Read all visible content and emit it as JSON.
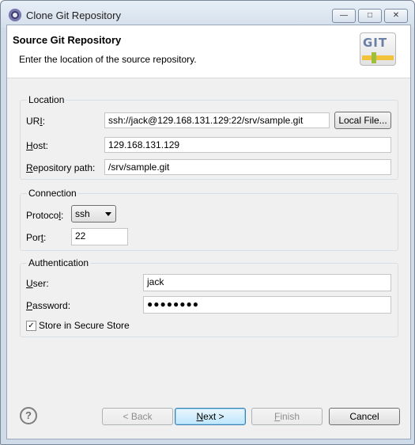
{
  "window": {
    "title": "Clone Git Repository",
    "controls": {
      "minimize": "—",
      "maximize": "□",
      "close": "✕"
    }
  },
  "header": {
    "title": "Source Git Repository",
    "description": "Enter the location of the source repository.",
    "icon_text": "GIT"
  },
  "location": {
    "legend": "Location",
    "uri_label_pre": "UR",
    "uri_label_u": "I",
    "uri_label_post": ":",
    "uri_value": "ssh://jack@129.168.131.129:22/srv/sample.git",
    "local_file_button": "Local File...",
    "host_label_u": "H",
    "host_label_post": "ost:",
    "host_value": "129.168.131.129",
    "repo_label_u": "R",
    "repo_label_post": "epository path:",
    "repo_value": "/srv/sample.git"
  },
  "connection": {
    "legend": "Connection",
    "protocol_label_pre": "Protoco",
    "protocol_label_u": "l",
    "protocol_label_post": ":",
    "protocol_value": "ssh",
    "port_label_pre": "Por",
    "port_label_u": "t",
    "port_label_post": ":",
    "port_value": "22"
  },
  "authentication": {
    "legend": "Authentication",
    "user_label_u": "U",
    "user_label_post": "ser:",
    "user_value": "jack",
    "password_label_u": "P",
    "password_label_post": "assword:",
    "password_value": "●●●●●●●●",
    "store_label": "Store in Secure Store",
    "store_checked": "✓"
  },
  "buttons": {
    "back": "< Back",
    "back_u": "B",
    "next_u": "N",
    "next_post": "ext >",
    "finish_u": "F",
    "finish_post": "inish",
    "cancel": "Cancel"
  },
  "help": "?"
}
